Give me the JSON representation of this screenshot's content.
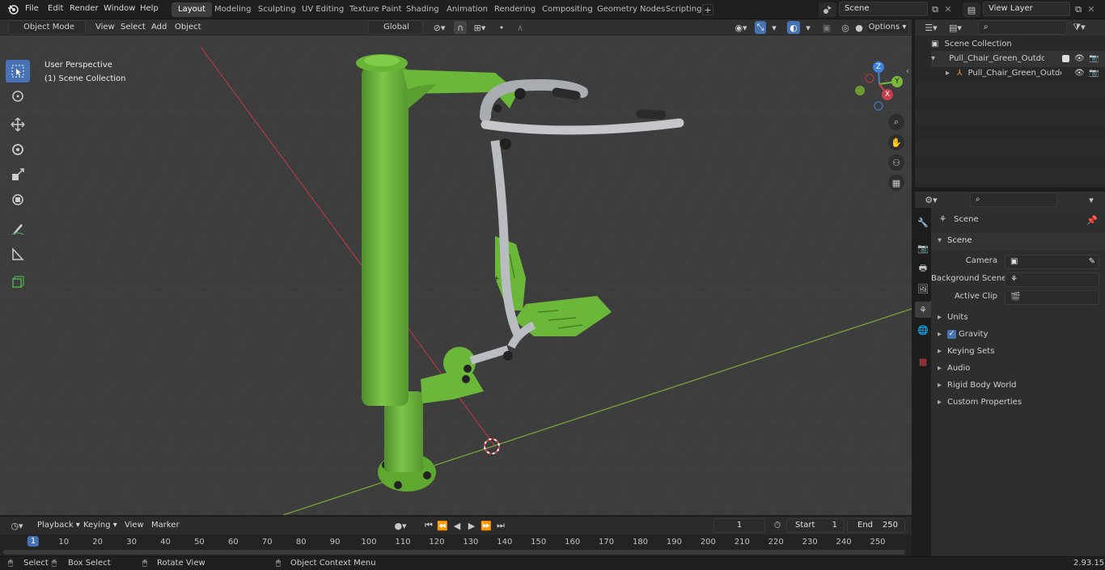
{
  "menus": [
    "File",
    "Edit",
    "Render",
    "Window",
    "Help"
  ],
  "workspaces": [
    "Layout",
    "Modeling",
    "Sculpting",
    "UV Editing",
    "Texture Paint",
    "Shading",
    "Animation",
    "Rendering",
    "Compositing",
    "Geometry Nodes",
    "Scripting"
  ],
  "active_workspace": "Layout",
  "scene_name": "Scene",
  "view_layer": "View Layer",
  "viewport": {
    "mode": "Object Mode",
    "menus": [
      "View",
      "Select",
      "Add",
      "Object"
    ],
    "transform_orientation": "Global",
    "options_label": "Options",
    "overlay_title": "User Perspective",
    "overlay_subtitle": "(1) Scene Collection",
    "gizmo_axes": {
      "z": "Z",
      "y": "Y",
      "x": "X"
    }
  },
  "outliner": {
    "root": "Scene Collection",
    "items": [
      "Pull_Chair_Green_Outdoor_Tr",
      "Pull_Chair_Green_Outdoc"
    ]
  },
  "properties": {
    "header": "Scene",
    "section": "Scene",
    "fields": [
      {
        "label": "Camera",
        "value": ""
      },
      {
        "label": "Background Scene",
        "value": ""
      },
      {
        "label": "Active Clip",
        "value": ""
      }
    ],
    "panels": [
      "Units",
      "Gravity",
      "Keying Sets",
      "Audio",
      "Rigid Body World",
      "Custom Properties"
    ],
    "gravity_checked": true
  },
  "timeline": {
    "menus": [
      "Playback",
      "Keying",
      "View",
      "Marker"
    ],
    "current_frame": "1",
    "start_label": "Start",
    "start": "1",
    "end_label": "End",
    "end": "250",
    "ticks": [
      "1",
      "10",
      "20",
      "30",
      "40",
      "50",
      "60",
      "70",
      "80",
      "90",
      "100",
      "110",
      "120",
      "130",
      "140",
      "150",
      "160",
      "170",
      "180",
      "190",
      "200",
      "210",
      "220",
      "230",
      "240",
      "250"
    ]
  },
  "statusbar": {
    "select": "Select",
    "box_select": "Box Select",
    "rotate_view": "Rotate View",
    "context_menu": "Object Context Menu",
    "version": "2.93.15"
  },
  "colors": {
    "accent": "#4772b3",
    "object_green": "#6fb83a",
    "metal": "#b7b9bd",
    "x_axis": "#c8414a",
    "y_axis": "#7ab93a",
    "z_axis": "#3d7fd9"
  }
}
